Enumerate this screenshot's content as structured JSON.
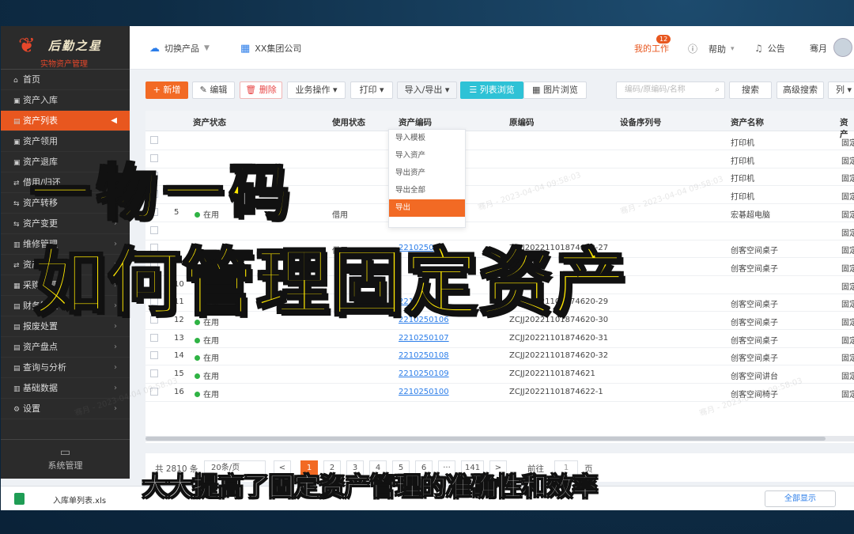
{
  "sidebar": {
    "logo_title": "后勤之星",
    "logo_subtitle": "实物资产管理",
    "items": [
      {
        "label": "首页",
        "icon": "home-icon",
        "glyph": "⌂"
      },
      {
        "label": "资产入库",
        "icon": "inbox-icon",
        "glyph": "▣"
      },
      {
        "label": "资产列表",
        "icon": "list-icon",
        "glyph": "▤",
        "active": true
      },
      {
        "label": "资产领用",
        "icon": "receive-icon",
        "glyph": "▣"
      },
      {
        "label": "资产退库",
        "icon": "return-icon",
        "glyph": "▣"
      },
      {
        "label": "借用/归还",
        "icon": "borrow-icon",
        "glyph": "⇄"
      },
      {
        "label": "资产转移",
        "icon": "transfer-icon",
        "glyph": "⇆"
      },
      {
        "label": "资产变更",
        "icon": "change-icon",
        "glyph": "⇆"
      },
      {
        "label": "维修管理",
        "icon": "repair-icon",
        "glyph": "▥"
      },
      {
        "label": "资产调拨",
        "icon": "allot-icon",
        "glyph": "⇄"
      },
      {
        "label": "采购管理",
        "icon": "purchase-icon",
        "glyph": "▦"
      },
      {
        "label": "财务管理",
        "icon": "finance-icon",
        "glyph": "▤"
      },
      {
        "label": "报废处置",
        "icon": "scrap-icon",
        "glyph": "▤"
      },
      {
        "label": "资产盘点",
        "icon": "inventory-icon",
        "glyph": "▤"
      },
      {
        "label": "查询与分析",
        "icon": "analysis-icon",
        "glyph": "▤"
      },
      {
        "label": "基础数据",
        "icon": "database-icon",
        "glyph": "▥"
      },
      {
        "label": "设置",
        "icon": "settings-icon",
        "glyph": "⚙"
      }
    ],
    "system_label": "系统管理"
  },
  "topbar": {
    "switch_product": "切换产品",
    "company": "XX集团公司",
    "my_work": "我的工作",
    "my_work_badge": "12",
    "help": "帮助",
    "notice": "公告",
    "user": "骞月"
  },
  "toolbar": {
    "new": "+ 新增",
    "edit": "编辑",
    "delete": "删除",
    "business": "业务操作",
    "print": "打印",
    "import_export": "导入/导出",
    "list_view": "列表浏览",
    "image_view": "图片浏览",
    "search_placeholder": "编码/原编码/名称",
    "search": "搜索",
    "advanced_search": "高级搜索",
    "columns": "列"
  },
  "dropdown": [
    "导入模板",
    "导入资产",
    "导出资产",
    "导出全部",
    "导出"
  ],
  "table": {
    "headers": [
      "资产状态",
      "使用状态",
      "资产编码",
      "原编码",
      "设备序列号",
      "资产名称",
      "资产"
    ],
    "rows": [
      {
        "no": "",
        "status": "",
        "usage": "",
        "code": "",
        "orig": "",
        "name": "打印机",
        "cat": "固定"
      },
      {
        "no": "",
        "status": "",
        "usage": "",
        "code": "",
        "orig": "",
        "name": "打印机",
        "cat": "固定"
      },
      {
        "no": "",
        "status": "",
        "usage": "",
        "code": "",
        "orig": "",
        "name": "打印机",
        "cat": "固定"
      },
      {
        "no": "",
        "status": "",
        "usage": "",
        "code": "",
        "orig": "",
        "name": "打印机",
        "cat": "固定"
      },
      {
        "no": "5",
        "status": "在用",
        "usage": "借用",
        "code": "",
        "orig": "",
        "name": "宏碁超电脑",
        "cat": "固定"
      },
      {
        "no": "",
        "status": "",
        "usage": "",
        "code": "",
        "orig": "",
        "name": "",
        "cat": "固定"
      },
      {
        "no": "",
        "status": "",
        "usage": "借用",
        "code": "2210250",
        "orig": "ZCJJ20221101874620-27",
        "name": "创客空间桌子",
        "cat": "固定"
      },
      {
        "no": "",
        "status": "",
        "usage": "",
        "code": "",
        "orig": "",
        "name": "创客空间桌子",
        "cat": "固定"
      },
      {
        "no": "10",
        "status": "",
        "usage": "",
        "code": "",
        "orig": "",
        "name": "",
        "cat": "固定"
      },
      {
        "no": "11",
        "status": "在用",
        "usage": "",
        "code": "2210250105",
        "orig": "ZCJJ20221101874620-29",
        "name": "创客空间桌子",
        "cat": "固定"
      },
      {
        "no": "12",
        "status": "在用",
        "usage": "",
        "code": "2210250106",
        "orig": "ZCJJ20221101874620-30",
        "name": "创客空间桌子",
        "cat": "固定"
      },
      {
        "no": "13",
        "status": "在用",
        "usage": "",
        "code": "2210250107",
        "orig": "ZCJJ20221101874620-31",
        "name": "创客空间桌子",
        "cat": "固定"
      },
      {
        "no": "14",
        "status": "在用",
        "usage": "",
        "code": "2210250108",
        "orig": "ZCJJ20221101874620-32",
        "name": "创客空间桌子",
        "cat": "固定"
      },
      {
        "no": "15",
        "status": "在用",
        "usage": "",
        "code": "2210250109",
        "orig": "ZCJJ20221101874621",
        "name": "创客空间讲台",
        "cat": "固定"
      },
      {
        "no": "16",
        "status": "在用",
        "usage": "",
        "code": "2210250100",
        "orig": "ZCJJ20221101874622-1",
        "name": "创客空间椅子",
        "cat": "固定"
      }
    ]
  },
  "pager": {
    "total": "共 2810 条",
    "page_size": "20条/页",
    "prev": "<",
    "pages": [
      "1",
      "2",
      "3",
      "4",
      "5",
      "6",
      "···",
      "141"
    ],
    "next": ">",
    "goto": "前往",
    "goto_value": "1",
    "page_unit": "页"
  },
  "download": {
    "file": "入库单列表.xls",
    "show_all": "全部显示"
  },
  "watermark": "骞月 - 2023-04-04 09:58:03",
  "overlay": {
    "headline_1": "一物一码",
    "headline_2": "如何管理固定资产",
    "subtitle": "大大提高了固定资产管理的准确性和效率"
  },
  "colors": {
    "accent": "#f26a24",
    "sidebar_bg": "#2b2b2b",
    "headline": "#ffe800",
    "link": "#2b7de9",
    "status_ok": "#2fb344"
  }
}
